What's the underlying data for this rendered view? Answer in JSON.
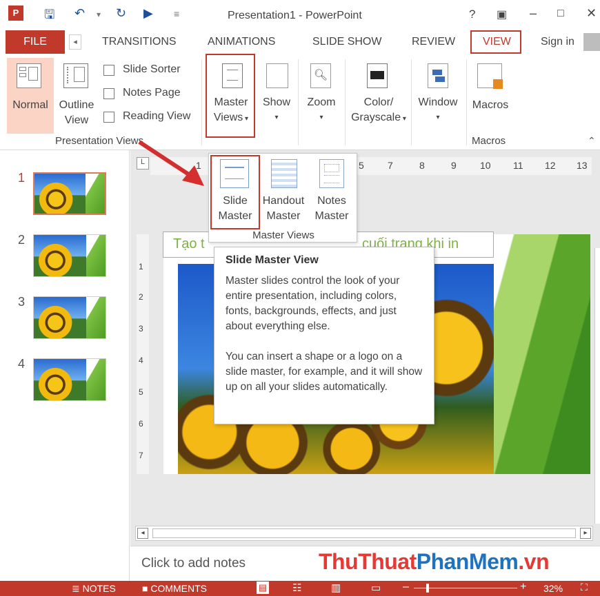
{
  "window": {
    "title": "Presentation1 - PowerPoint",
    "help_label": "?",
    "sign_in": "Sign in"
  },
  "tabs": {
    "file": "FILE",
    "transitions": "TRANSITIONS",
    "animations": "ANIMATIONS",
    "slide_show": "SLIDE SHOW",
    "review": "REVIEW",
    "view": "VIEW"
  },
  "ribbon": {
    "presentation_views": {
      "normal": "Normal",
      "outline_view": [
        "Outline",
        "View"
      ],
      "slide_sorter": "Slide Sorter",
      "notes_page": "Notes Page",
      "reading_view": "Reading View",
      "group_label": "Presentation Views"
    },
    "master_views": [
      "Master",
      "Views"
    ],
    "show": "Show",
    "zoom": "Zoom",
    "color_grayscale": [
      "Color/",
      "Grayscale"
    ],
    "window": "Window",
    "macros": "Macros",
    "macros_group": "Macros"
  },
  "dropdown": {
    "slide_master": [
      "Slide",
      "Master"
    ],
    "handout_master": [
      "Handout",
      "Master"
    ],
    "notes_master": [
      "Notes",
      "Master"
    ],
    "group_label": "Master Views"
  },
  "tooltip": {
    "title": "Slide Master View",
    "para1": "Master slides control the look of your entire presentation, including colors, fonts, backgrounds, effects, and just about everything else.",
    "para2": "You can insert a shape or a logo on a slide master, for example, and it will show up on all your slides automatically."
  },
  "slides": [
    {
      "number": "1"
    },
    {
      "number": "2"
    },
    {
      "number": "3"
    },
    {
      "number": "4"
    }
  ],
  "slide_title_visible": "Tạo t",
  "slide_title_visible_right": "cuối trang khi in",
  "ruler_ticks": [
    "1",
    "5",
    "7",
    "8",
    "9",
    "10",
    "11",
    "12",
    "13"
  ],
  "vruler_ticks": [
    "1",
    "2",
    "3",
    "4",
    "5",
    "6",
    "7"
  ],
  "notes_placeholder": "Click to add notes",
  "watermark": "ThuThuatPhanMem.vn",
  "status": {
    "notes": "NOTES",
    "comments": "COMMENTS",
    "zoom": "32%"
  },
  "colors": {
    "accent_red": "#c0392b",
    "slide_title_green": "#7cb342",
    "watermark_blue": "#1e73be",
    "watermark_red": "#e53935"
  }
}
